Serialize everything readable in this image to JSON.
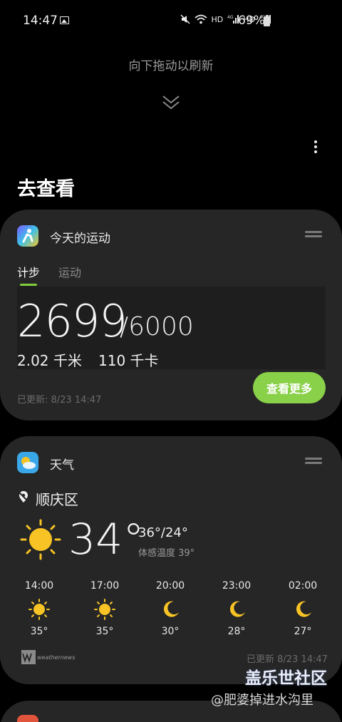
{
  "status_bar": {
    "time": "14:47",
    "net_labels": [
      "HD",
      "4G",
      "HD",
      "4G"
    ],
    "battery": "69%"
  },
  "pull_hint": "向下拖动以刷新",
  "section_title": "去查看",
  "steps_card": {
    "title": "今天的运动",
    "tab_active": "计步",
    "tab_inactive": "运动",
    "steps": "2699",
    "goal": "/6000",
    "distance": "2.02 千米",
    "calories": "110 千卡",
    "updated": "已更新:  8/23 14:47",
    "view_more": "查看更多"
  },
  "weather_card": {
    "title": "天气",
    "location": "顺庆区",
    "temperature": "34°",
    "range": "36°/24°",
    "feels_like": "体感温度 39°",
    "hourly": [
      {
        "time": "14:00",
        "icon": "sun-icon",
        "temp": "35°"
      },
      {
        "time": "17:00",
        "icon": "sun-icon",
        "temp": "35°"
      },
      {
        "time": "20:00",
        "icon": "moon-icon",
        "temp": "30°"
      },
      {
        "time": "23:00",
        "icon": "moon-icon",
        "temp": "28°"
      },
      {
        "time": "02:00",
        "icon": "moon-icon",
        "temp": "27°"
      }
    ],
    "provider": "weathernews",
    "updated": "已更新 8/23 14:47"
  },
  "watermark": {
    "main": "盖乐世社区",
    "sub": "@肥婆掉进水沟里"
  },
  "colors": {
    "accent_green": "#8ad14a",
    "card_bg": "#262626",
    "sun_yellow": "#f7c325"
  }
}
